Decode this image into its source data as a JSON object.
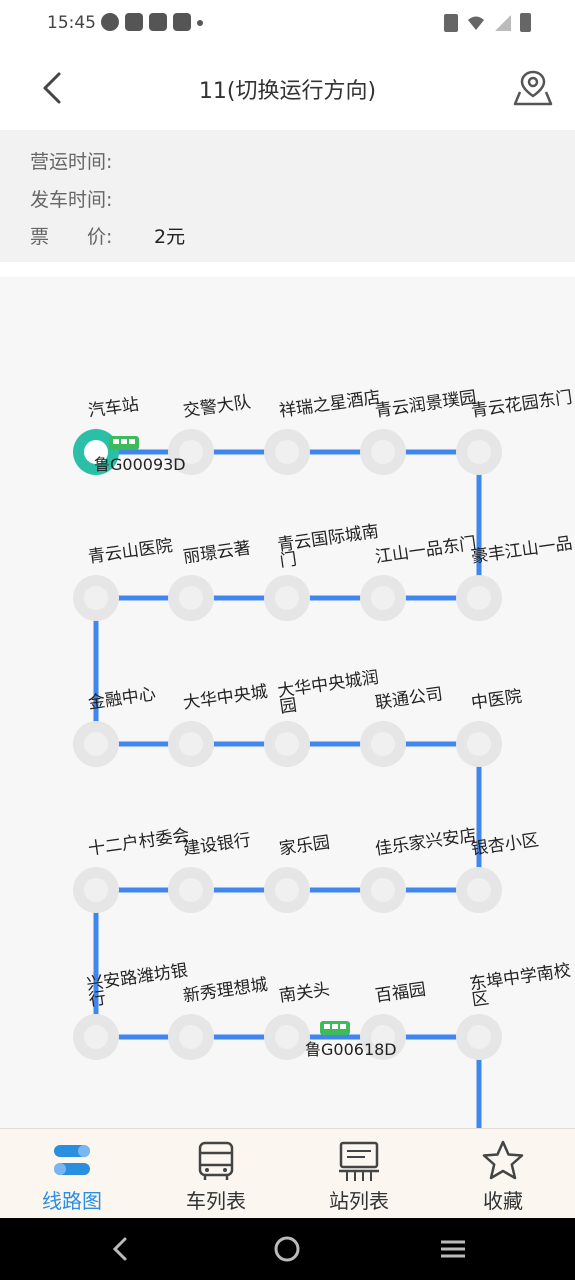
{
  "status_bar": {
    "time": "15:45"
  },
  "header": {
    "title": "11(切换运行方向)"
  },
  "info": {
    "operating_label": "营运时间:",
    "operating_value": "",
    "departure_label": "发车时间:",
    "departure_value": "",
    "fare_label": "票　　价:",
    "fare_value": "2元"
  },
  "route": {
    "line_color": "#3f87ee",
    "stop_color": "#e6e6e6",
    "first_stop_color": "#2bbfa8",
    "bus_color": "#3fba5a",
    "rows": [
      [
        "汽车站",
        "交警大队",
        "祥瑞之星酒店",
        "青云润景璞园",
        "青云花园东门"
      ],
      [
        "豪丰江山一品",
        "江山一品东门",
        "青云国际城南门",
        "丽璟云著",
        "青云山医院"
      ],
      [
        "金融中心",
        "大华中央城",
        "大华中央城润园",
        "联通公司",
        "中医院"
      ],
      [
        "银杏小区",
        "佳乐家兴安店",
        "家乐园",
        "建设银行",
        "十二户村委会"
      ],
      [
        "兴安路潍坊银行",
        "新秀理想城",
        "南关头",
        "百福园",
        "东埠中学南校区"
      ]
    ],
    "buses": [
      {
        "plate": "鲁G00093D",
        "row": 0,
        "at": 0
      },
      {
        "plate": "鲁G00618D",
        "row": 4,
        "at": 2.5
      }
    ]
  },
  "tabs": [
    {
      "label": "线路图",
      "icon": "route-map-icon",
      "active": true
    },
    {
      "label": "车列表",
      "icon": "bus-icon",
      "active": false
    },
    {
      "label": "站列表",
      "icon": "station-board-icon",
      "active": false
    },
    {
      "label": "收藏",
      "icon": "star-icon",
      "active": false
    }
  ],
  "colors": {
    "accent": "#2b8fe0",
    "tab_bg": "#fbf7f0",
    "info_bg": "#f2f2f2"
  }
}
